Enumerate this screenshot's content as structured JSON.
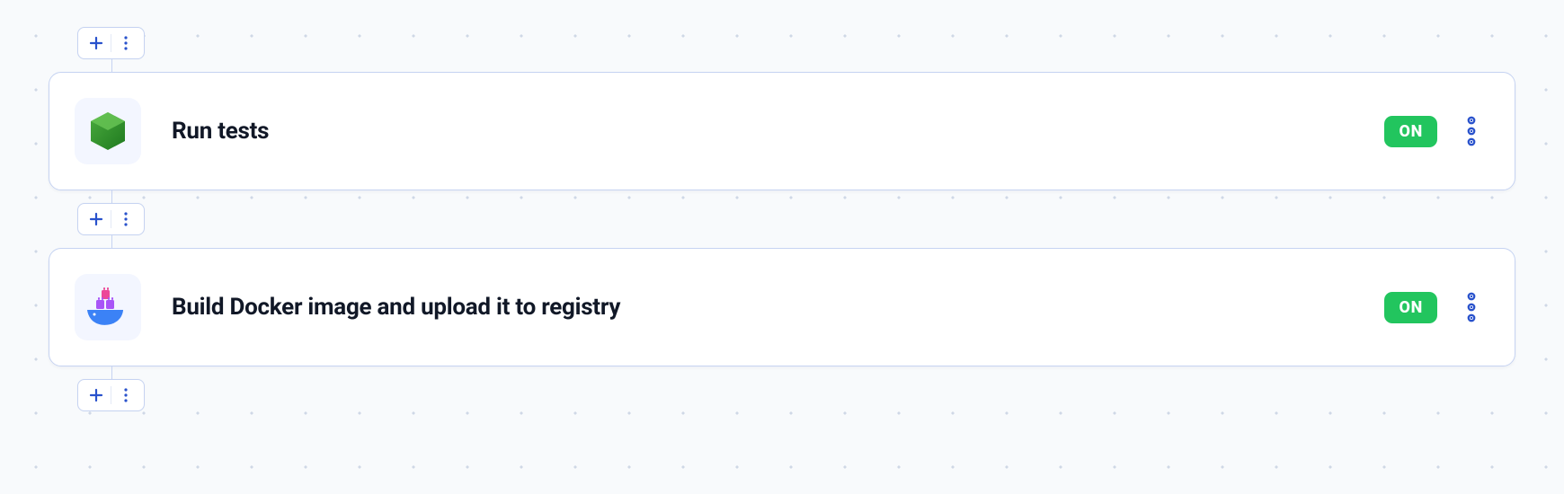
{
  "colors": {
    "border": "#c6d3f2",
    "accent": "#2952cc",
    "badge_on_bg": "#22c55e",
    "badge_on_fg": "#ffffff"
  },
  "steps": [
    {
      "title": "Run tests",
      "badge": "ON",
      "icon": "hexagon-icon"
    },
    {
      "title": "Build Docker image and upload it to registry",
      "badge": "ON",
      "icon": "docker-icon"
    }
  ],
  "insert_button": {
    "plus_label": "+",
    "menu_label": "⋮"
  }
}
